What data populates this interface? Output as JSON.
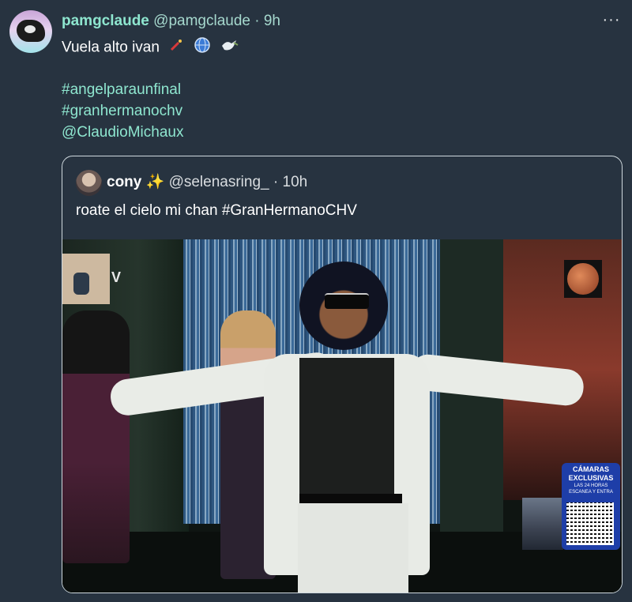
{
  "post": {
    "display_name": "pamgclaude",
    "handle": "@pamgclaude",
    "separator": "·",
    "time": "9h",
    "text": "Vuela alto ivan",
    "emojis": [
      "firecracker-emoji",
      "globe-emoji",
      "dove-emoji"
    ],
    "hashtags": [
      "#angelparaunfinal",
      "#granhermanochv"
    ],
    "mention": "@ClaudioMichaux",
    "more_label": "···"
  },
  "quoted": {
    "display_name": "cony ✨",
    "handle": "@selenasring_",
    "separator": "·",
    "time": "10h",
    "text": "roate el cielo mi chan #GranHermanoCHV",
    "media": {
      "overlay_letter": "V",
      "promo_line1": "CÁMARAS",
      "promo_line2": "EXCLUSIVAS",
      "promo_line3": "LAS 24 HORAS",
      "promo_line4": "ESCANEA Y ENTRA"
    }
  },
  "colors": {
    "background": "#273340",
    "accent": "#8ee6cf",
    "text": "#ffffff"
  }
}
